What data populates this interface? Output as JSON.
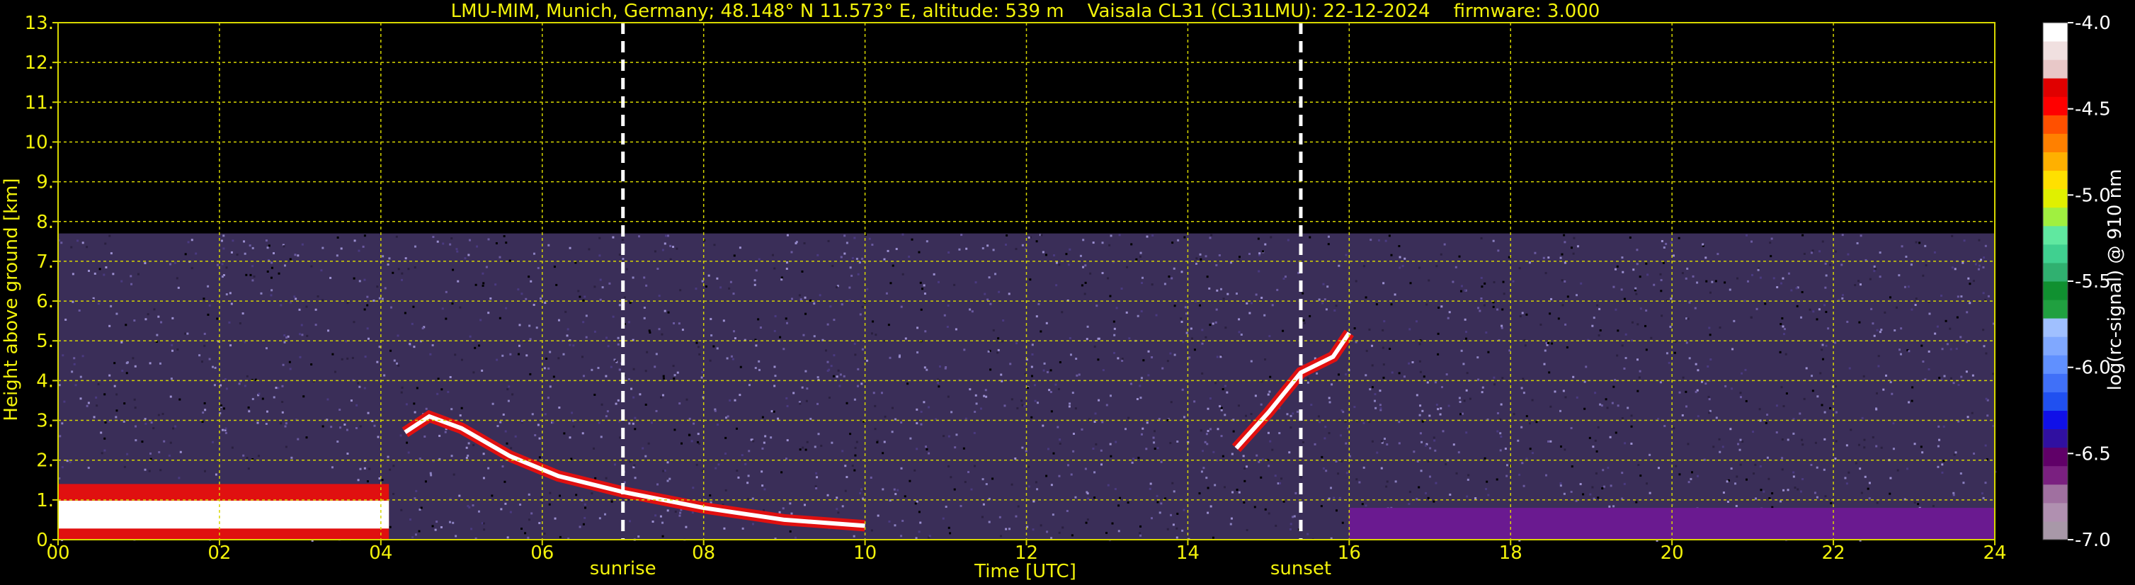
{
  "chart_data": {
    "type": "heatmap",
    "title": "LMU-MIM, Munich, Germany; 48.148° N 11.573° E, altitude: 539 m    Vaisala CL31 (CL31LMU): 22-12-2024    firmware: 3.000",
    "xlabel": "Time [UTC]",
    "ylabel": "Height above ground [km]",
    "xlim": [
      0,
      24
    ],
    "ylim": [
      0,
      13
    ],
    "x_ticks": [
      "00",
      "02",
      "04",
      "06",
      "08",
      "10",
      "12",
      "14",
      "16",
      "18",
      "20",
      "22",
      "24"
    ],
    "y_ticks": [
      "0.",
      "1.",
      "2.",
      "3.",
      "4.",
      "5.",
      "6.",
      "7.",
      "8.",
      "9.",
      "10.",
      "11.",
      "12.",
      "13."
    ],
    "grid": true,
    "max_signal_height_km": 7.7,
    "markers": [
      {
        "label": "sunrise",
        "time_utc": 7.0
      },
      {
        "label": "sunset",
        "time_utc": 15.4
      }
    ],
    "colorbar": {
      "label": "log(rc-signal) @ 910 nm",
      "range": [
        -7.0,
        -4.0
      ],
      "ticks": [
        "-4.0",
        "-4.5",
        "-5.0",
        "-5.5",
        "-6.0",
        "-6.5",
        "-7.0"
      ],
      "colors": [
        "#a898a8",
        "#b090b0",
        "#a070a0",
        "#7a2080",
        "#600068",
        "#3010a0",
        "#1010e8",
        "#2050f0",
        "#4070f8",
        "#6090ff",
        "#80a8ff",
        "#a0c0ff",
        "#20a040",
        "#109030",
        "#30b070",
        "#40d090",
        "#60e8a0",
        "#a0f040",
        "#e0f000",
        "#ffe000",
        "#ffb000",
        "#ff8000",
        "#ff5000",
        "#ff0000",
        "#e00000",
        "#e8c8c8",
        "#f0e0e0",
        "#ffffff"
      ]
    },
    "features": [
      {
        "name": "boundary_layer_aerosol",
        "start": 0.0,
        "end": 4.1,
        "base_km": 0.0,
        "top_km": 1.4,
        "intensity": "high"
      },
      {
        "name": "rising_layer",
        "points": [
          [
            4.3,
            2.7
          ],
          [
            4.6,
            3.1
          ],
          [
            5.0,
            2.8
          ],
          [
            5.6,
            2.1
          ],
          [
            6.2,
            1.6
          ],
          [
            7.0,
            1.2
          ],
          [
            8.0,
            0.8
          ],
          [
            9.0,
            0.5
          ],
          [
            10.0,
            0.35
          ]
        ]
      },
      {
        "name": "cloud_band_sunset",
        "points": [
          [
            14.6,
            2.3
          ],
          [
            15.0,
            3.2
          ],
          [
            15.4,
            4.2
          ],
          [
            15.8,
            4.6
          ],
          [
            16.0,
            5.2
          ]
        ]
      },
      {
        "name": "surface_layer_evening",
        "start": 16.0,
        "end": 24.0,
        "base_km": 0.0,
        "top_km": 0.8,
        "intensity": "low"
      }
    ]
  }
}
